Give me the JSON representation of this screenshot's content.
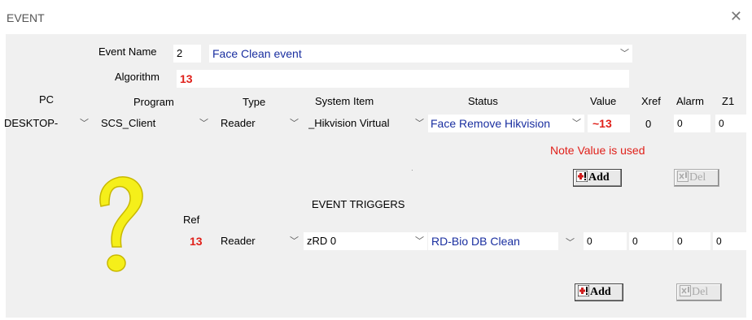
{
  "window": {
    "title": "EVENT"
  },
  "event": {
    "event_name_label": "Event Name",
    "event_number": "2",
    "event_name": "Face Clean event",
    "algorithm_label": "Algorithm",
    "algorithm_value": "13"
  },
  "headers": [
    "PC",
    "Program",
    "Type",
    "System Item",
    "Status",
    "Value",
    "Xref",
    "Alarm",
    "Z1"
  ],
  "row": {
    "pc": "DESKTOP-",
    "program": "SCS_Client",
    "type": "Reader",
    "system_item": "_Hikvision Virtual",
    "status": "Face Remove Hikvision",
    "value": "~13",
    "xref": "0",
    "alarm": "0",
    "z1": "0"
  },
  "note": "Note Value is used",
  "buttons": {
    "add": "Add",
    "del": "Del"
  },
  "triggers": {
    "heading": "EVENT TRIGGERS",
    "ref_label": "Ref",
    "ref_value": "13",
    "type": "Reader",
    "item": "zRD 0",
    "status": "RD-Bio DB Clean",
    "v1": "0",
    "v2": "0",
    "v3": "0",
    "v4": "0"
  },
  "colors": {
    "accent_red": "#e0201a",
    "text_blue": "#1a2fa0",
    "question_yellow": "#f5ef1a"
  }
}
